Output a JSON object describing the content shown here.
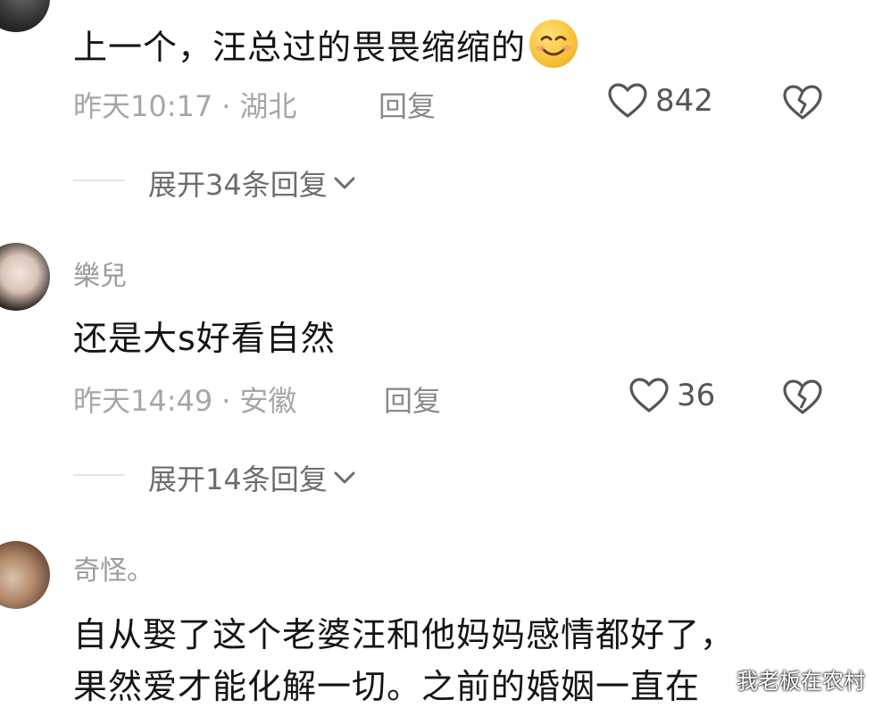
{
  "comments": [
    {
      "username": "",
      "text": "上一个，汪总过的畏畏缩缩的",
      "time": "昨天10:17",
      "location": "湖北",
      "reply_label": "回复",
      "likes": "842",
      "expand_label": "展开34条回复"
    },
    {
      "username": "樂兒",
      "text": "还是大s好看自然",
      "time": "昨天14:49",
      "location": "安徽",
      "reply_label": "回复",
      "likes": "36",
      "expand_label": "展开14条回复"
    },
    {
      "username": "奇怪。",
      "text_line1": "自从娶了这个老婆汪和他妈妈感情都好了，",
      "text_line2": "果然爱才能化解一切。之前的婚姻一直在"
    }
  ],
  "separator": "·",
  "icons": {
    "like": "heart-outline-icon",
    "dislike": "broken-heart-icon",
    "expand": "chevron-down-icon",
    "emoji": "smiling-face-emoji"
  },
  "watermark": "我老板在农村",
  "colors": {
    "text": "#141414",
    "muted": "#a6a6a6",
    "reply": "#8a8a8a",
    "expand": "#6d6d6d"
  }
}
